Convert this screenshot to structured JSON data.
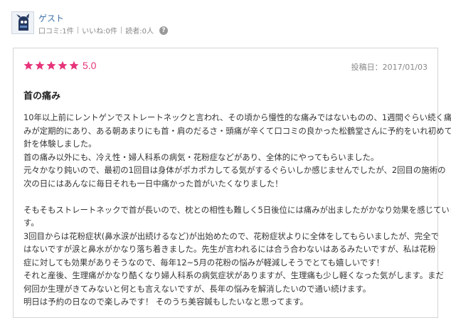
{
  "user": {
    "name": "ゲスト",
    "stats": [
      "口コミ:1件",
      "いいね:0件",
      "読者:0人"
    ],
    "help_icon": "?"
  },
  "review": {
    "rating": 5,
    "rating_text": "5.0",
    "post_date": "投稿日：2017/01/03",
    "title": "首の痛み",
    "lines": [
      "10年以上前にレントゲンでストレートネックと言われ、その頃から慢性的な痛みではないものの、1週間ぐらい続く痛",
      "みが定期的にあり、ある朝あまりにも首・肩のだるさ・頭痛が辛くて口コミの良かった松鶴堂さんに予約をいれ初めて",
      "針を体験しました。",
      "首の痛み以外にも、冷え性・婦人科系の病気・花粉症などがあり、全体的にやってもらいました。",
      "元々かなり鈍いので、最初の1回目は身体がポカポカしてる気がするぐらいしか感じませんでしたが、2回目の施術の",
      "次の日にはあんなに毎日それも一日中痛かった首がいたくなりました！",
      "",
      "そもそもストレートネックで首が長いので、枕との相性も難しく5日後位には痛みが出ましたがかなり効果を感じていま",
      "す。",
      "3回目からは花粉症状(鼻水涙が出続けるなど)が出始めたので、花粉症状よりに全体をしてもらいましたが、完全で",
      "はないですが涙と鼻水がかなり落ち着きました。先生が言われるには合う合わないはあるみたいですが、私は花粉",
      "症に対しても効果がありそうなので、毎年12~5月の花粉の悩みが軽減しそうでとても嬉しいです！",
      "それと産後、生理痛がかなり酷くなり婦人科系の病気症状がありますが、生理痛も少し軽くなった気がします。まだ",
      "何回か生理がきてみないと何とも言えないですが、長年の悩みを解消したいので通い続けます。",
      "明日は予約の日なので楽しみです！ そのうち美容鍼もしたいなと思ってます。"
    ]
  },
  "colors": {
    "star": "#e6347a",
    "link": "#3b6ea5"
  },
  "icons": {
    "avatar": "user-avatar-icon",
    "star": "star-icon",
    "help": "question-icon"
  }
}
